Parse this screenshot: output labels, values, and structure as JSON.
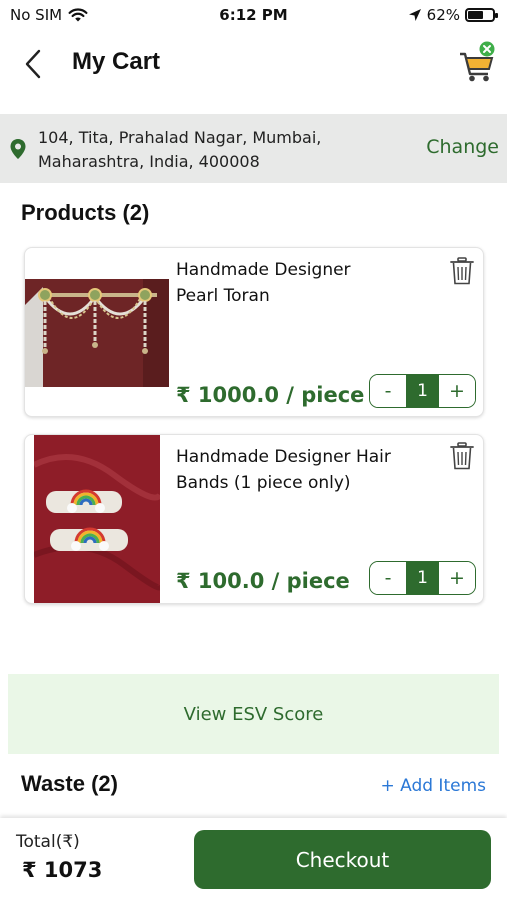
{
  "status_bar": {
    "carrier": "No SIM",
    "time": "6:12 PM",
    "battery": "62%",
    "battery_level": 0.62
  },
  "header": {
    "title": "My Cart"
  },
  "address": {
    "line1": "104, Tita, Prahalad Nagar, Mumbai,",
    "line2": "Maharashtra, India, 400008",
    "change_label": "Change"
  },
  "products": {
    "title": "Products (2)",
    "items": [
      {
        "name_line1": "Handmade Designer",
        "name_line2": "Pearl Toran",
        "price": "₹ 1000.0 / piece",
        "quantity": "1",
        "minus": "-",
        "plus": "+"
      },
      {
        "name_line1": "Handmade Designer Hair",
        "name_line2": "Bands (1 piece only)",
        "price": "₹ 100.0 / piece",
        "quantity": "1",
        "minus": "-",
        "plus": "+"
      }
    ]
  },
  "esv": {
    "label": "View ESV Score"
  },
  "waste": {
    "title": "Waste (2)",
    "add_label": "+ Add Items"
  },
  "footer": {
    "total_label": "Total(₹)",
    "total_value": "₹ 1073",
    "checkout_label": "Checkout"
  },
  "colors": {
    "accent": "#2e6b2e",
    "light_green": "#eaf7e7",
    "address_bg": "#e8e9e8",
    "link_blue": "#2b78d6"
  }
}
